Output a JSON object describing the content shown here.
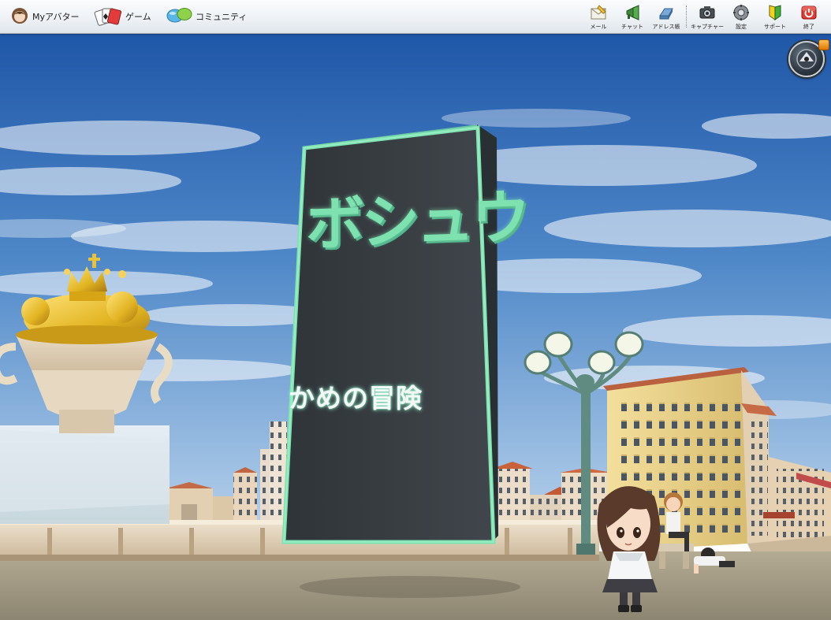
{
  "nav": {
    "avatar_label": "Myアバター",
    "game_label": "ゲーム",
    "community_label": "コミュニティ"
  },
  "toolbar": {
    "mail_label": "メール",
    "chat_label": "チャット",
    "address_label": "アドレス帳",
    "capture_label": "キャプチャー",
    "settings_label": "設定",
    "support_label": "サポート",
    "exit_label": "終了"
  },
  "monolith": {
    "title": "ボシュウ",
    "subtitle": "かめの冒険"
  },
  "colors": {
    "sky_top": "#1f57a8",
    "sky_bottom": "#b9d3ec",
    "monolith_face": "#3a3f44",
    "monolith_glow": "#7ee2b0",
    "fountain_gold": "#e2b422",
    "building_yellow": "#ecd58c",
    "exit_red": "#d9302b"
  },
  "icons": [
    "avatar-icon",
    "cards-icon",
    "speech-bubbles-icon",
    "mail-icon",
    "megaphone-icon",
    "address-book-icon",
    "camera-icon",
    "gear-icon",
    "beginner-mark-icon",
    "power-icon",
    "compass-icon"
  ]
}
